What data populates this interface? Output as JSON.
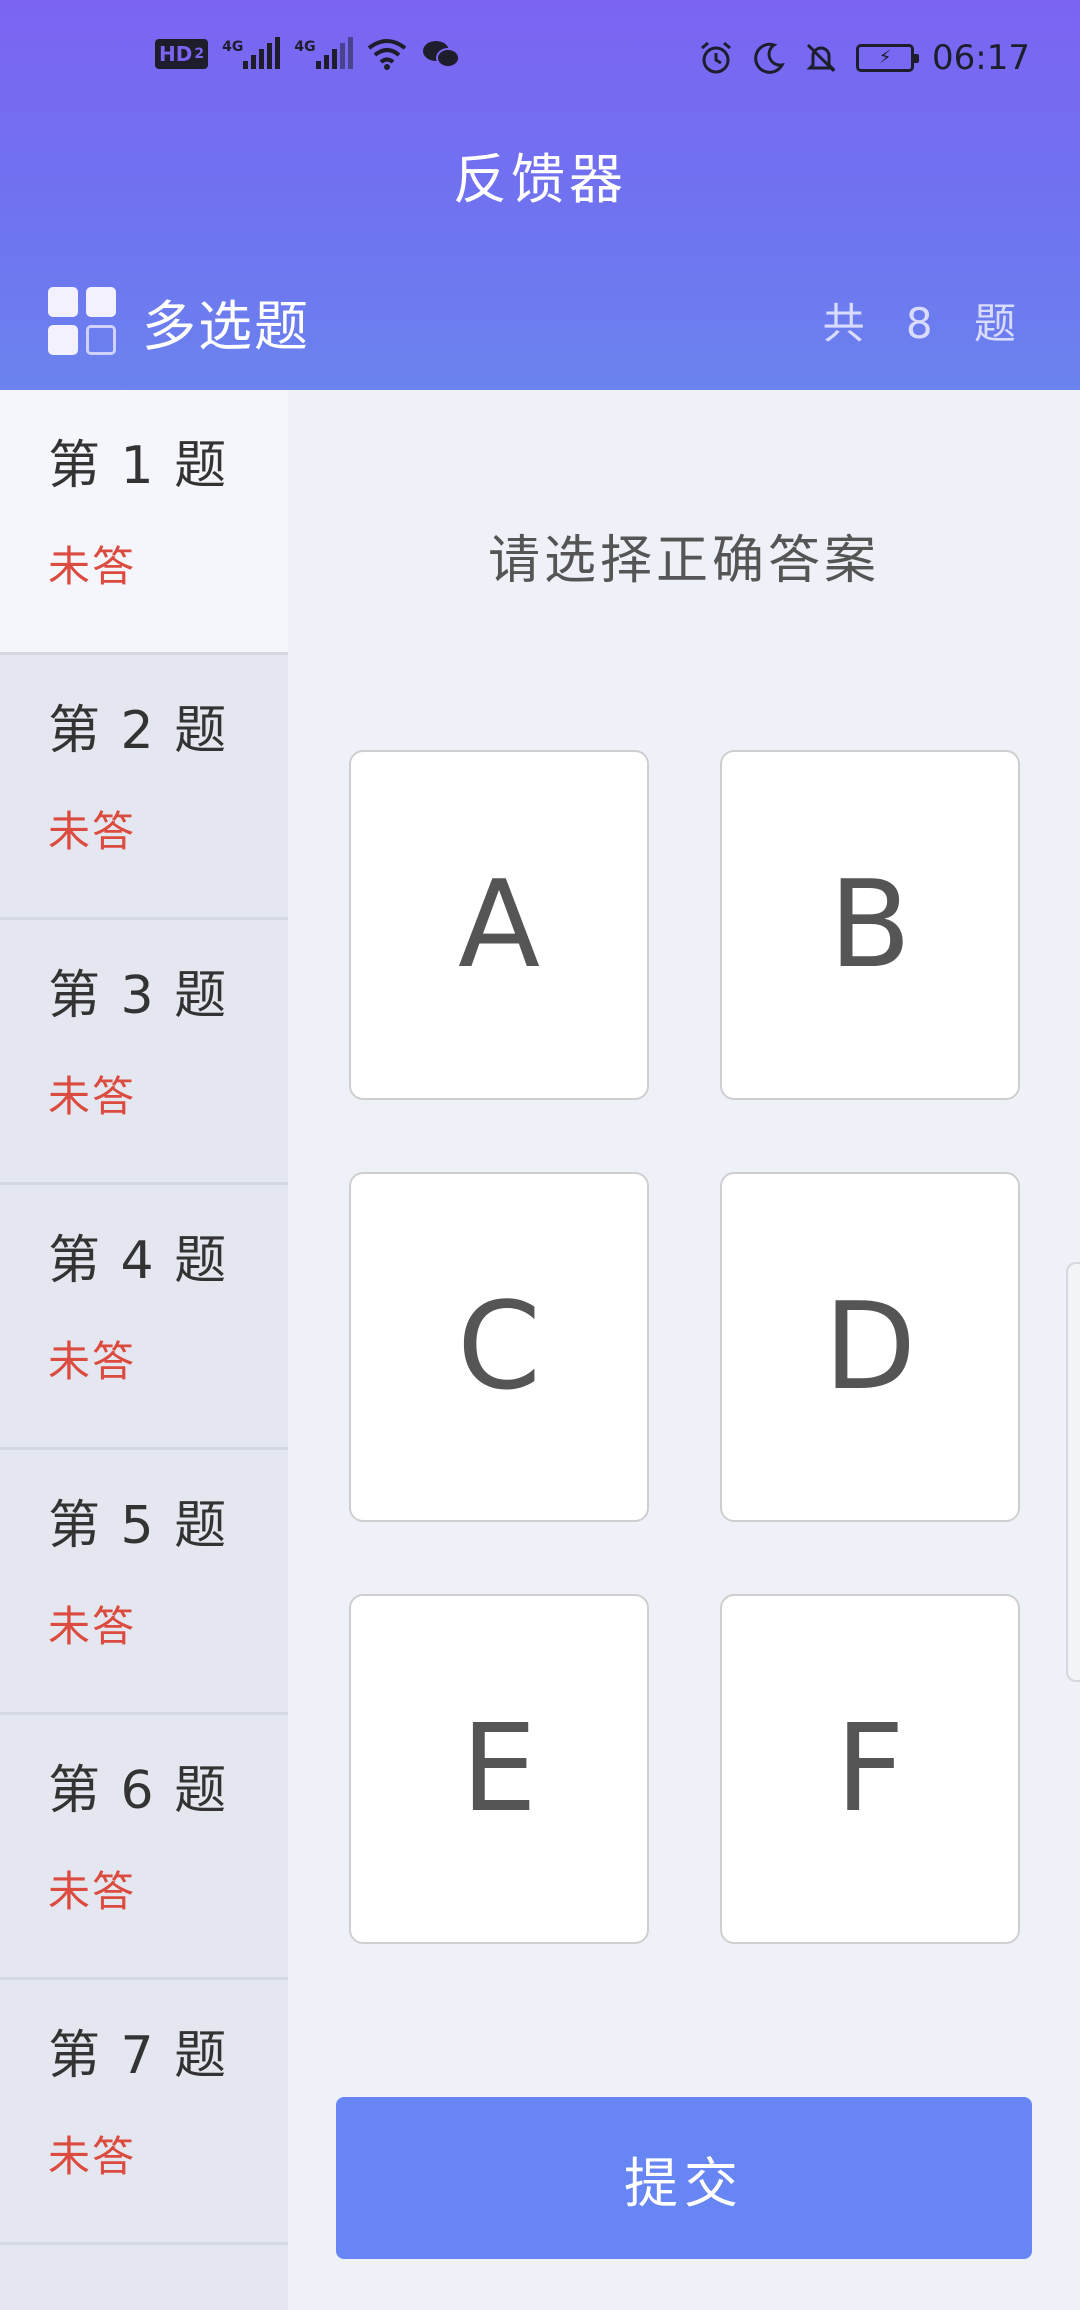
{
  "status_bar": {
    "network_badge": "HD",
    "network_badge_sub": "2",
    "sim1_type": "4G",
    "sim2_type": "4G",
    "time": "06:17"
  },
  "header": {
    "title": "反馈器",
    "mode_title": "多选题",
    "total_label": "共 8 题",
    "gradient_start": "#7b64f2",
    "gradient_end": "#6b83ee"
  },
  "questions": [
    {
      "label": "第 1 题",
      "status": "未答",
      "active": true
    },
    {
      "label": "第 2 题",
      "status": "未答"
    },
    {
      "label": "第 3 题",
      "status": "未答"
    },
    {
      "label": "第 4 题",
      "status": "未答"
    },
    {
      "label": "第 5 题",
      "status": "未答"
    },
    {
      "label": "第 6 题",
      "status": "未答"
    },
    {
      "label": "第 7 题",
      "status": "未答"
    }
  ],
  "main": {
    "prompt": "请选择正确答案",
    "options": [
      "A",
      "B",
      "C",
      "D",
      "E",
      "F"
    ],
    "submit_label": "提交"
  },
  "colors": {
    "accent": "#6886f3",
    "unanswered": "#dc4b3f",
    "sidebar_bg": "#e4e7ef"
  },
  "icons": {
    "mode": "grid-icon",
    "alarm": "alarm-icon",
    "moon": "moon-icon",
    "bell_off": "bell-off-icon",
    "battery": "battery-charging-icon",
    "wifi": "wifi-icon",
    "wechat": "wechat-icon"
  }
}
